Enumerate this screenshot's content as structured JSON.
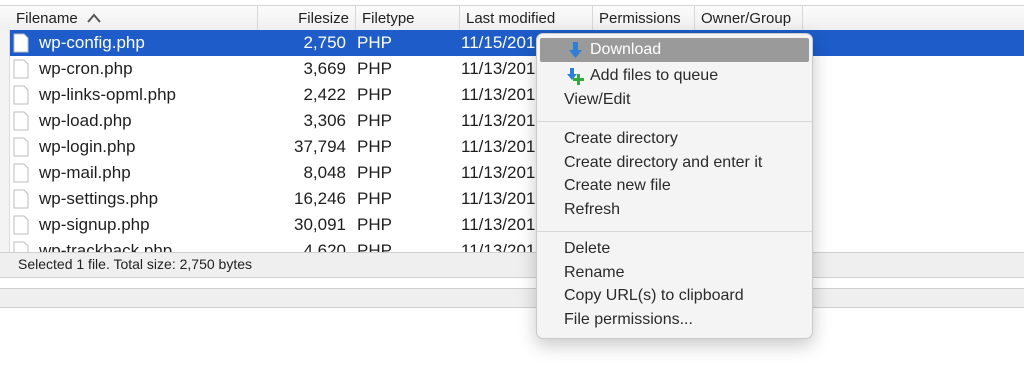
{
  "columns": {
    "filename": "Filename",
    "filesize": "Filesize",
    "filetype": "Filetype",
    "last_modified": "Last modified",
    "permissions": "Permissions",
    "owner_group": "Owner/Group",
    "sort_icon": "chevron-up-icon"
  },
  "files": [
    {
      "name": "wp-config.php",
      "size": "2,750",
      "type": "PHP",
      "modified": "11/15/201"
    },
    {
      "name": "wp-cron.php",
      "size": "3,669",
      "type": "PHP",
      "modified": "11/13/201"
    },
    {
      "name": "wp-links-opml.php",
      "size": "2,422",
      "type": "PHP",
      "modified": "11/13/201"
    },
    {
      "name": "wp-load.php",
      "size": "3,306",
      "type": "PHP",
      "modified": "11/13/201"
    },
    {
      "name": "wp-login.php",
      "size": "37,794",
      "type": "PHP",
      "modified": "11/13/201"
    },
    {
      "name": "wp-mail.php",
      "size": "8,048",
      "type": "PHP",
      "modified": "11/13/201"
    },
    {
      "name": "wp-settings.php",
      "size": "16,246",
      "type": "PHP",
      "modified": "11/13/201"
    },
    {
      "name": "wp-signup.php",
      "size": "30,091",
      "type": "PHP",
      "modified": "11/13/201"
    },
    {
      "name": "wp-trackback.php",
      "size": "4,620",
      "type": "PHP",
      "modified": "11/13/201"
    }
  ],
  "selected_file": "wp-config.php",
  "status": "Selected 1 file. Total size: 2,750 bytes",
  "context_menu": {
    "download": "Download",
    "add_to_queue": "Add files to queue",
    "view_edit": "View/Edit",
    "create_directory": "Create directory",
    "create_directory_enter": "Create directory and enter it",
    "create_new_file": "Create new file",
    "refresh": "Refresh",
    "delete": "Delete",
    "rename": "Rename",
    "copy_url": "Copy URL(s) to clipboard",
    "file_permissions": "File permissions..."
  },
  "colors": {
    "selection": "#1d5cc9",
    "menu_highlight": "#9a9a9a",
    "download_icon": "#2f7fd8",
    "queue_icon": "#35a844"
  }
}
